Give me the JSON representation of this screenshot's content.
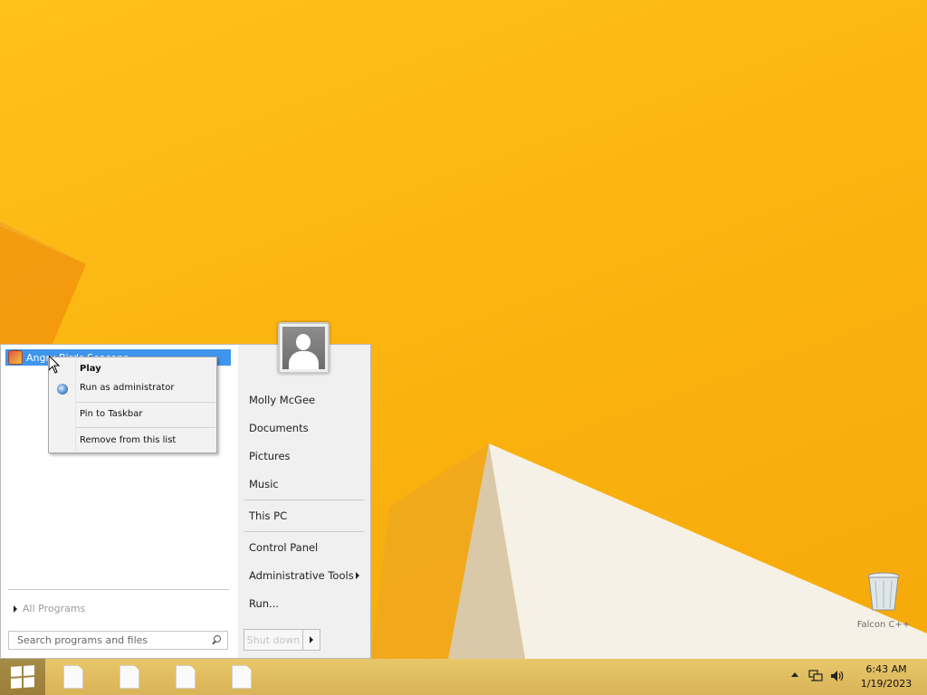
{
  "start_menu": {
    "pinned_program": "Angry Birds Seasons",
    "all_programs": "All Programs",
    "search_placeholder": "Search programs and files",
    "links": {
      "user": "Molly McGee",
      "documents": "Documents",
      "pictures": "Pictures",
      "music": "Music",
      "this_pc": "This PC",
      "control_panel": "Control Panel",
      "admin_tools": "Administrative Tools",
      "run": "Run..."
    },
    "shutdown_label": "Shut down"
  },
  "context_menu": {
    "play": "Play",
    "run_as_admin": "Run as administrator",
    "pin_taskbar": "Pin to Taskbar",
    "remove": "Remove from this list"
  },
  "desktop": {
    "recycle_bin_label": "Falcon C++"
  },
  "taskbar": {
    "time": "6:43 AM",
    "date": "1/19/2023",
    "pinned_icons": [
      "document-icon",
      "document-icon",
      "document-icon",
      "document-icon"
    ]
  },
  "colors": {
    "wallpaper": "#fbb410",
    "highlight": "#3f95ec",
    "taskbar": "#dfbc60"
  }
}
